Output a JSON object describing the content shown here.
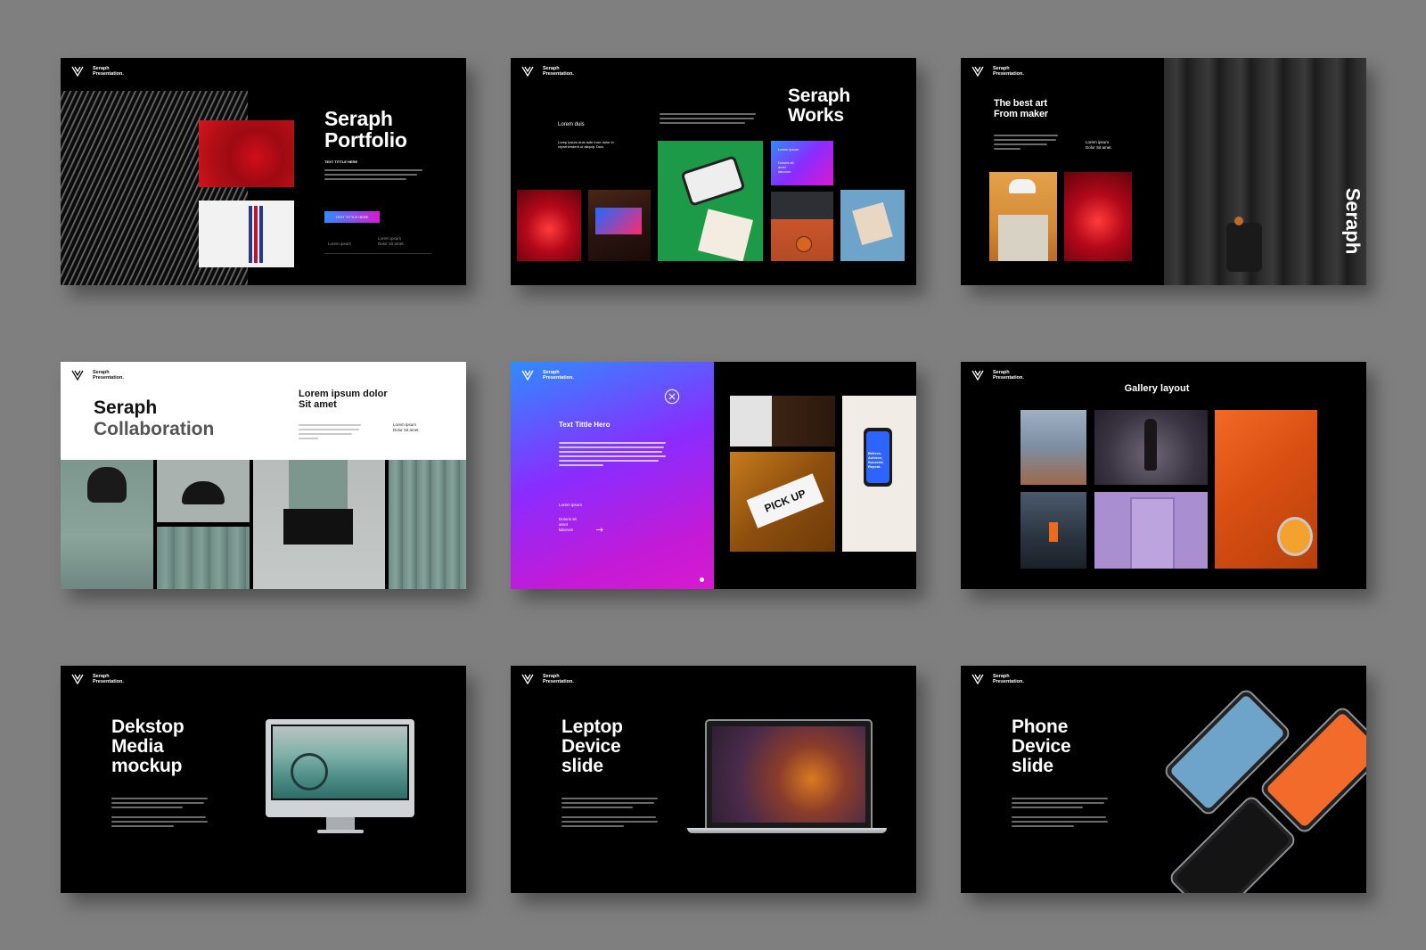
{
  "brand": {
    "line1": "Seraph",
    "line2": "Presentation."
  },
  "slides": {
    "portfolio": {
      "title_line1": "Seraph",
      "title_line2": "Portfolio",
      "text_title": "TEXT TITTLE HERE",
      "button_label": "TEXT TITTLE HERE",
      "footer_left": "Lorem ipsum",
      "footer_right": "Lorem ipsum Dolor Sit amet."
    },
    "works": {
      "title_line1": "Seraph",
      "title_line2": "Works",
      "left_heading": "Lorem duis",
      "left_body": "Lorep ipsum duis aute irure dolor in reprehenderit ut aliquip. Duis",
      "card_title": "Lorem ipsum",
      "card_body": "Doloris sit amet laborum"
    },
    "art": {
      "title_line1": "The best art",
      "title_line2": "From maker",
      "side_text": "Lorem ipsum Dolor Sit amet.",
      "vertical_label": "Seraph"
    },
    "collab": {
      "title_line1": "Seraph",
      "title_line2": "Collaboration",
      "heading_line1": "Lorem ipsum dolor",
      "heading_line2": "Sit amet",
      "side_text": "Lorem ipsum Dolor Sit amet."
    },
    "text_title": {
      "heading": "Text Tittle Hero",
      "label": "Lorem ipsum",
      "sub": "Doloris sit amet laborum",
      "pickup_sign": "PICK UP",
      "phone_text": "Believe, Achieve, Succeed, Repeat."
    },
    "gallery": {
      "heading": "Gallery layout"
    },
    "desktop": {
      "title_line1": "Dekstop",
      "title_line2": "Media",
      "title_line3": "mockup"
    },
    "laptop": {
      "title_line1": "Leptop",
      "title_line2": "Device",
      "title_line3": "slide"
    },
    "phone": {
      "title_line1": "Phone",
      "title_line2": "Device",
      "title_line3": "slide"
    }
  },
  "colors": {
    "background": "#7f7f7f",
    "slide_bg": "#000000",
    "gradient_start": "#2f8cff",
    "gradient_mid": "#8a2cff",
    "gradient_end": "#d81ad0"
  },
  "icons": [
    "seraph-logo-icon",
    "close-circle-icon",
    "arrow-right-icon"
  ]
}
